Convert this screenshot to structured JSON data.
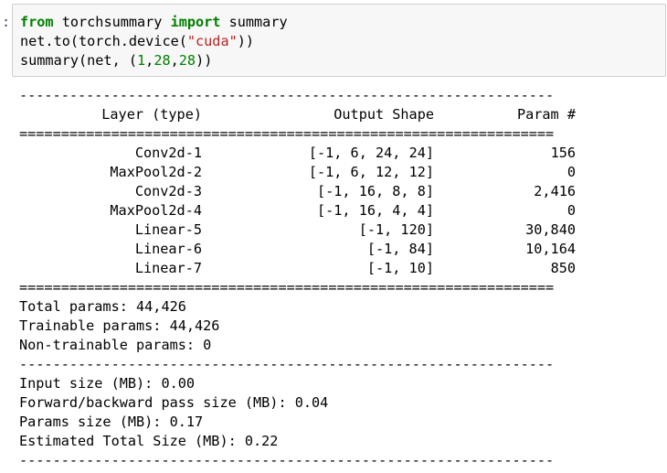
{
  "prompt": ":",
  "code_lines": [
    [
      {
        "t": "from",
        "c": "kw"
      },
      {
        "t": " torchsummary ",
        "c": ""
      },
      {
        "t": "import",
        "c": "kw"
      },
      {
        "t": " summary",
        "c": ""
      }
    ],
    [
      {
        "t": "net.to(torch.device(",
        "c": ""
      },
      {
        "t": "\"cuda\"",
        "c": "str"
      },
      {
        "t": "))",
        "c": ""
      }
    ],
    [
      {
        "t": "summary(net, (",
        "c": ""
      },
      {
        "t": "1",
        "c": "num"
      },
      {
        "t": ",",
        "c": ""
      },
      {
        "t": "28",
        "c": "num"
      },
      {
        "t": ",",
        "c": ""
      },
      {
        "t": "28",
        "c": "num"
      },
      {
        "t": "))",
        "c": ""
      }
    ]
  ],
  "output": {
    "dash_line": "----------------------------------------------------------------",
    "eq_line": "================================================================",
    "headers": {
      "layer": "Layer (type)",
      "shape": "Output Shape",
      "param": "Param #"
    },
    "rows": [
      {
        "layer": "Conv2d-1",
        "shape": "[-1, 6, 24, 24]",
        "param": "156"
      },
      {
        "layer": "MaxPool2d-2",
        "shape": "[-1, 6, 12, 12]",
        "param": "0"
      },
      {
        "layer": "Conv2d-3",
        "shape": "[-1, 16, 8, 8]",
        "param": "2,416"
      },
      {
        "layer": "MaxPool2d-4",
        "shape": "[-1, 16, 4, 4]",
        "param": "0"
      },
      {
        "layer": "Linear-5",
        "shape": "[-1, 120]",
        "param": "30,840"
      },
      {
        "layer": "Linear-6",
        "shape": "[-1, 84]",
        "param": "10,164"
      },
      {
        "layer": "Linear-7",
        "shape": "[-1, 10]",
        "param": "850"
      }
    ],
    "totals": [
      "Total params: 44,426",
      "Trainable params: 44,426",
      "Non-trainable params: 0"
    ],
    "sizes": [
      "Input size (MB): 0.00",
      "Forward/backward pass size (MB): 0.04",
      "Params size (MB): 0.17",
      "Estimated Total Size (MB): 0.22"
    ]
  }
}
